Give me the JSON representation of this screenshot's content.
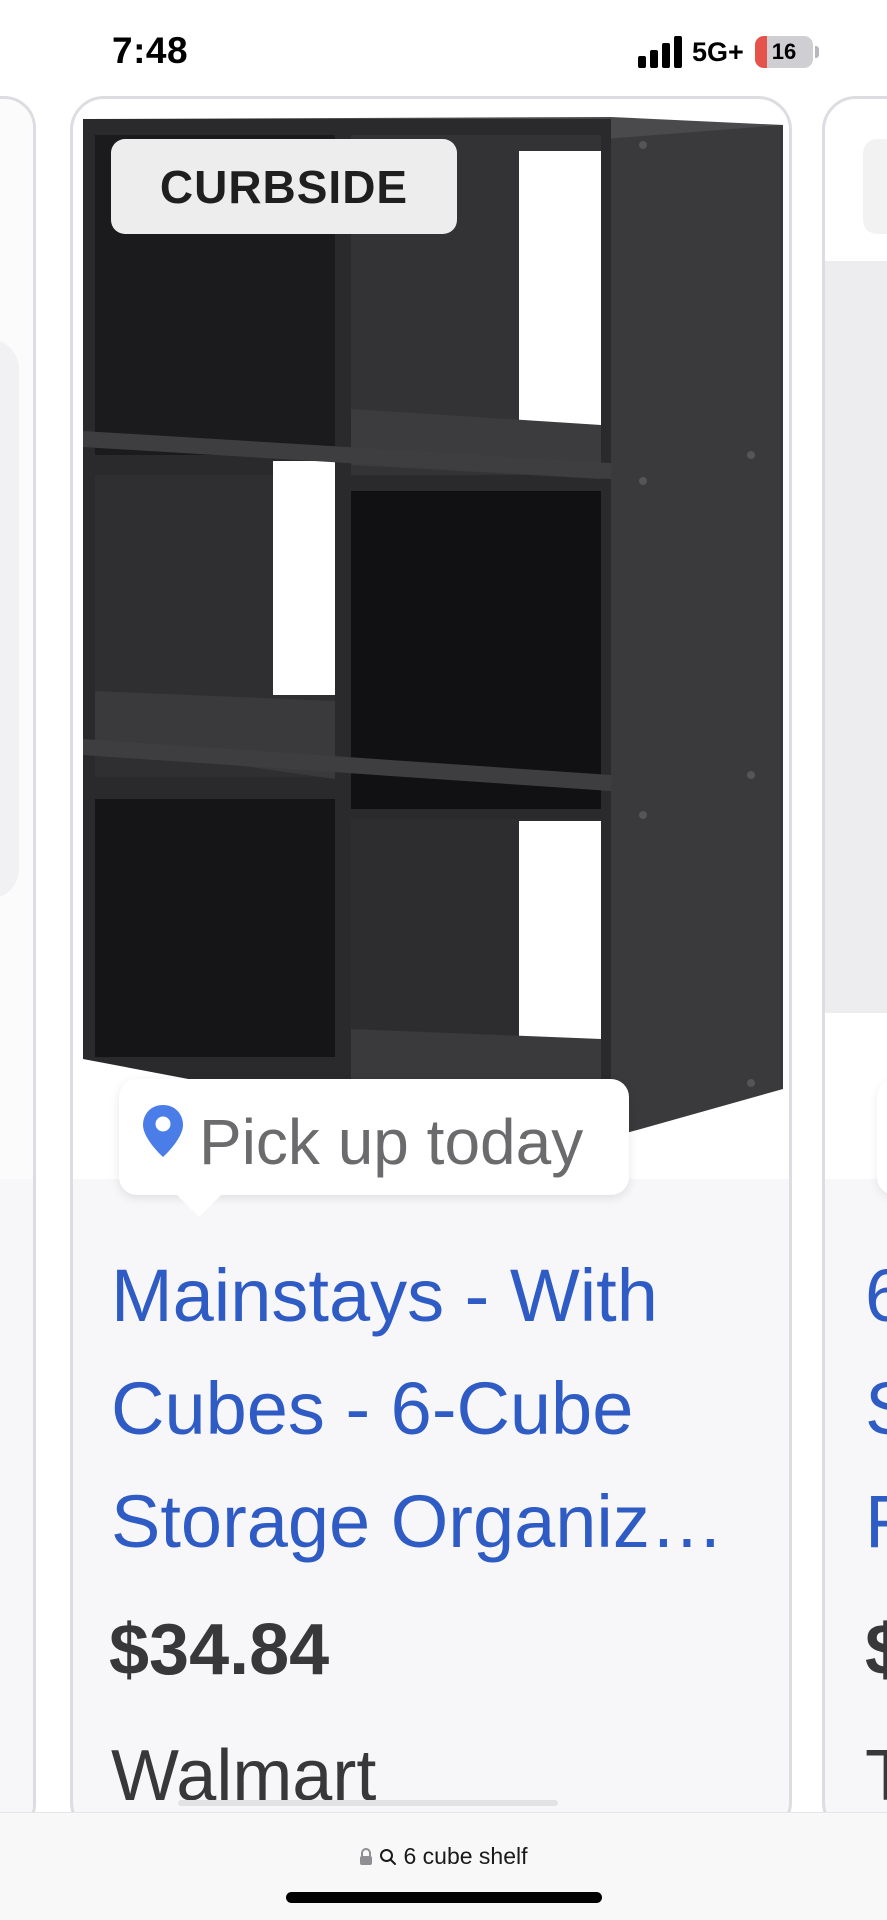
{
  "status_bar": {
    "time": "7:48",
    "network": "5G+",
    "battery_level": "16",
    "battery_fill_fraction": 0.16
  },
  "product_card": {
    "badge": "CURBSIDE",
    "pickup_label": "Pick up today",
    "title_lines": [
      "Mainstays - With",
      "Cubes - 6-Cube",
      "Storage Organiz…"
    ],
    "price": "$34.84",
    "store": "Walmart",
    "image_description_icon": "cube-shelf-image"
  },
  "next_card": {
    "title_lines": [
      "6",
      "S",
      "F"
    ],
    "price": "$",
    "store": "T"
  },
  "address_bar": {
    "query": "6 cube shelf",
    "icons": [
      "lock-icon",
      "search-icon"
    ]
  },
  "colors": {
    "title_link": "#2f5bc4",
    "pin": "#4a7de8",
    "price_text": "#38383a",
    "battery_low": "#e5534b"
  }
}
